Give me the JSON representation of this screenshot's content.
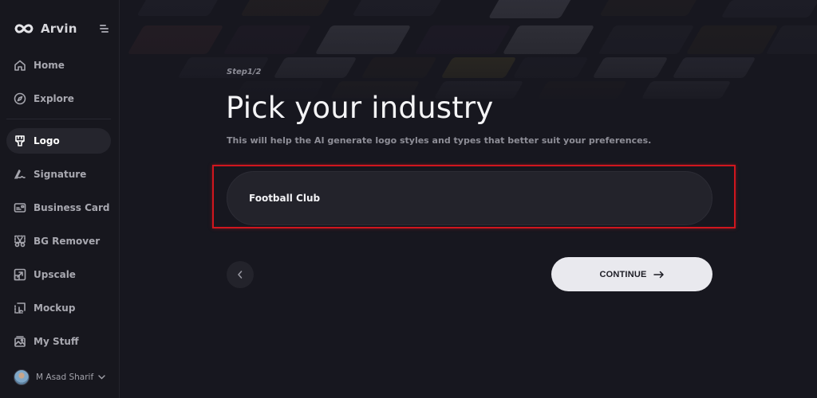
{
  "app": {
    "name": "Arvin"
  },
  "sidebar": {
    "items": [
      {
        "label": "Home",
        "icon": "home-icon",
        "active": false
      },
      {
        "label": "Explore",
        "icon": "compass-icon",
        "active": false
      },
      {
        "label": "Logo",
        "icon": "brush-icon",
        "active": true
      },
      {
        "label": "Signature",
        "icon": "signature-icon",
        "active": false
      },
      {
        "label": "Business Card",
        "icon": "card-icon",
        "active": false
      },
      {
        "label": "BG Remover",
        "icon": "scissors-icon",
        "active": false
      },
      {
        "label": "Upscale",
        "icon": "upscale-icon",
        "active": false
      },
      {
        "label": "Mockup",
        "icon": "mockup-icon",
        "active": false
      },
      {
        "label": "My Stuff",
        "icon": "gallery-icon",
        "active": false
      }
    ],
    "user": {
      "name": "M Asad Sharif"
    }
  },
  "main": {
    "step": "Step1/2",
    "title": "Pick your industry",
    "subtitle": "This will help the AI generate logo styles and types that better suit your preferences.",
    "industry_input": {
      "value": "Football Club",
      "placeholder": ""
    },
    "continue_label": "CONTINUE"
  },
  "colors": {
    "background": "#17171f",
    "highlight": "#d0161e",
    "button": "#e9e9ee"
  }
}
